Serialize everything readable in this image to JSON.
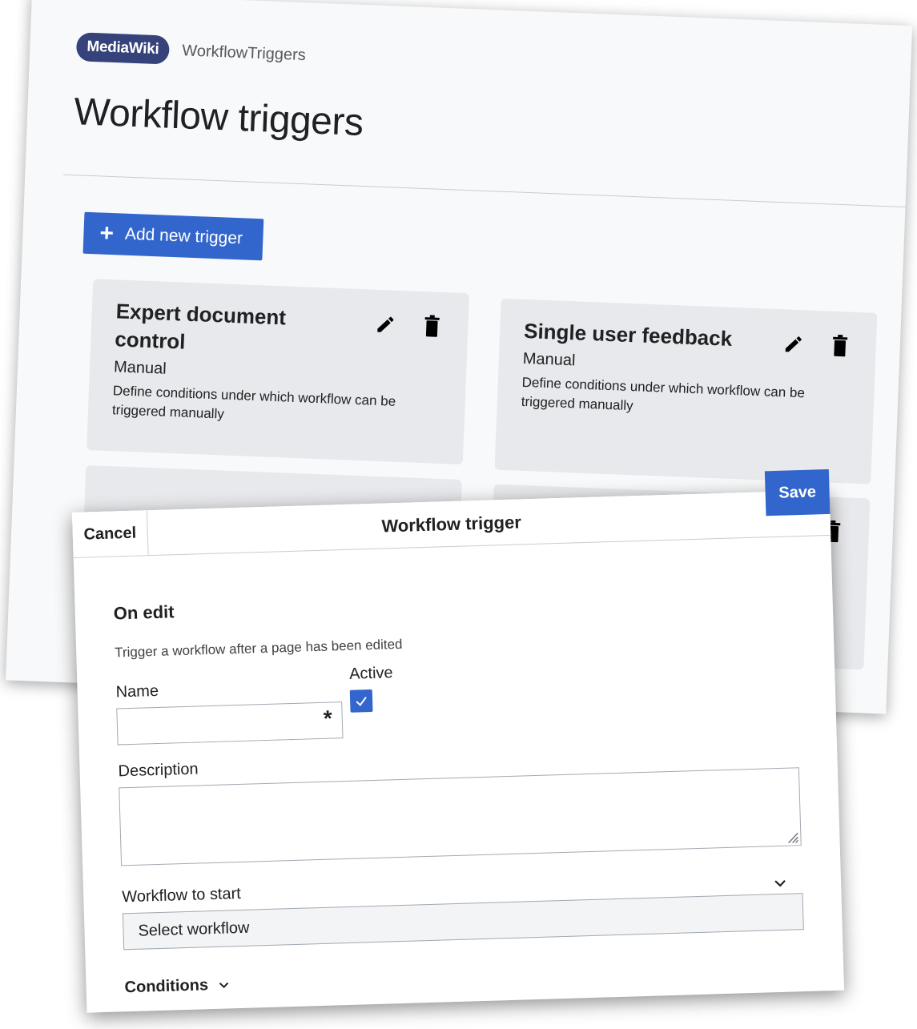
{
  "background_page": {
    "badge": "MediaWiki",
    "breadcrumb": "WorkflowTriggers",
    "title": "Workflow triggers",
    "add_button_label": "Add new trigger",
    "cards": [
      {
        "title": "Expert document control",
        "type": "Manual",
        "description": "Define conditions under which workflow can be triggered manually"
      },
      {
        "title": "Single user feedback",
        "type": "Manual",
        "description": "Define conditions under which workflow can be triggered manually"
      }
    ]
  },
  "dialog": {
    "title": "Workflow trigger",
    "cancel_label": "Cancel",
    "save_label": "Save",
    "section_heading": "On edit",
    "section_description": "Trigger a workflow after a page has been edited",
    "name_label": "Name",
    "name_value": "",
    "required_marker": "*",
    "active_label": "Active",
    "active_checked": true,
    "description_label": "Description",
    "description_value": "",
    "workflow_label": "Workflow to start",
    "workflow_selected": "Select workflow",
    "conditions_label": "Conditions"
  },
  "colors": {
    "brand_badge": "#36427a",
    "primary": "#3366cc",
    "card_bg": "#e8e9ec"
  },
  "icons": [
    "plus-icon",
    "pencil-icon",
    "trash-icon",
    "checkmark-icon",
    "chevron-down-icon",
    "resize-grip-icon"
  ]
}
